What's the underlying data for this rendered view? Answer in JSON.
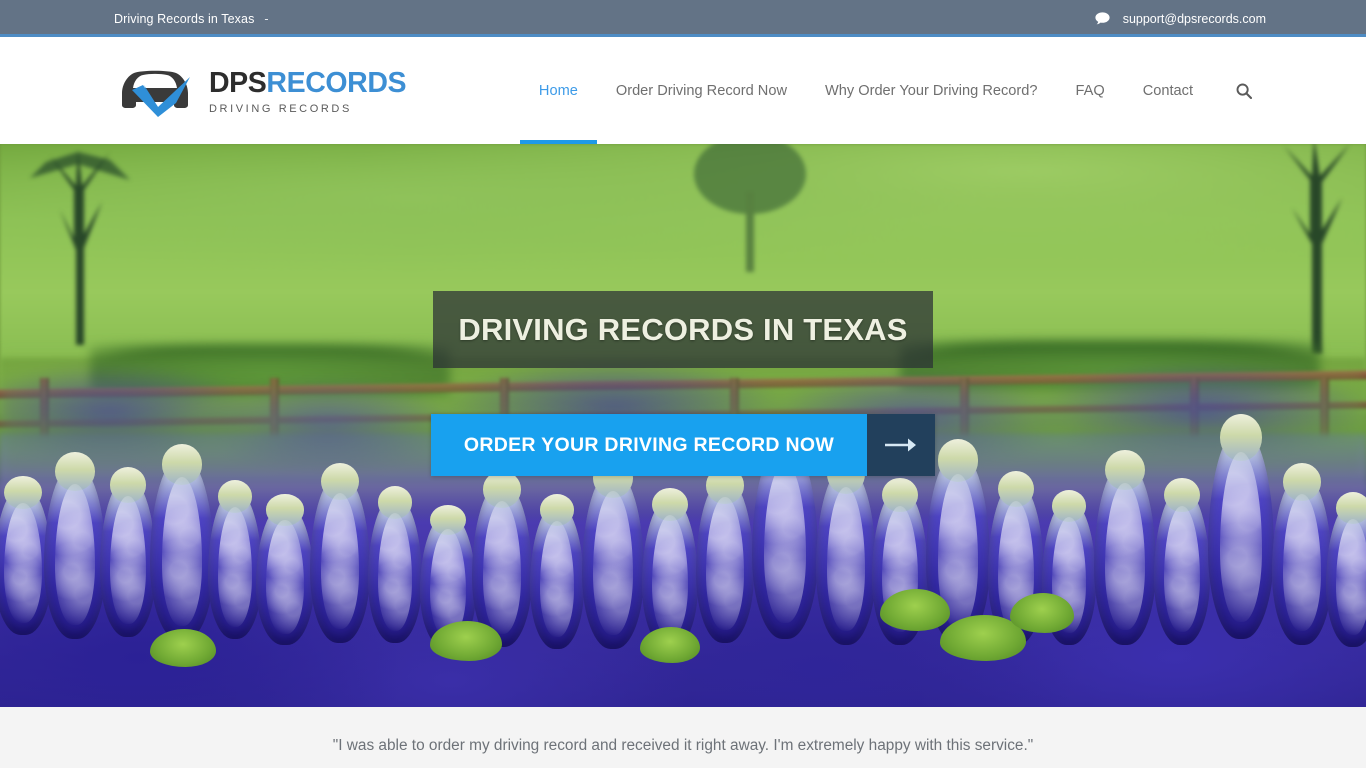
{
  "topbar": {
    "site_title": "Driving Records in Texas",
    "separator": "-",
    "chat_icon": "chat-bubble-icon",
    "email": "support@dpsrecords.com",
    "background_color": "#637386",
    "accent_line_color": "#4e8cc4"
  },
  "header": {
    "logo": {
      "icon": "car-checkmark-icon",
      "title_primary": "DPS",
      "title_secondary": "RECORDS",
      "subtitle": "DRIVING RECORDS",
      "primary_color": "#2d2d2d",
      "secondary_color": "#3d8fd4"
    },
    "nav": [
      {
        "label": "Home",
        "active": true
      },
      {
        "label": "Order Driving Record Now",
        "active": false
      },
      {
        "label": "Why Order Your Driving Record?",
        "active": false
      },
      {
        "label": "FAQ",
        "active": false
      },
      {
        "label": "Contact",
        "active": false
      }
    ],
    "search_icon": "search-icon",
    "active_color": "#3d9be8",
    "active_underline_color": "#1e9ae8",
    "inactive_color": "#6f6f6f"
  },
  "hero": {
    "image_description": "Texas bluebonnet field with wooden fence and green pasture",
    "title": "DRIVING RECORDS IN TEXAS",
    "title_color": "#eef0e1",
    "title_box_color": "rgba(42,47,52,0.72)",
    "cta_label": "ORDER YOUR DRIVING RECORD NOW",
    "cta_color": "#18a1ef",
    "cta_arrow_icon": "arrow-right-icon",
    "cta_arrow_block_color": "#22405c"
  },
  "testimonial": {
    "quote": "\"I was able to order my driving record and received it right away.  I'm extremely happy with this service.\"",
    "background_color": "#f4f4f4",
    "text_color": "#6d7278"
  }
}
